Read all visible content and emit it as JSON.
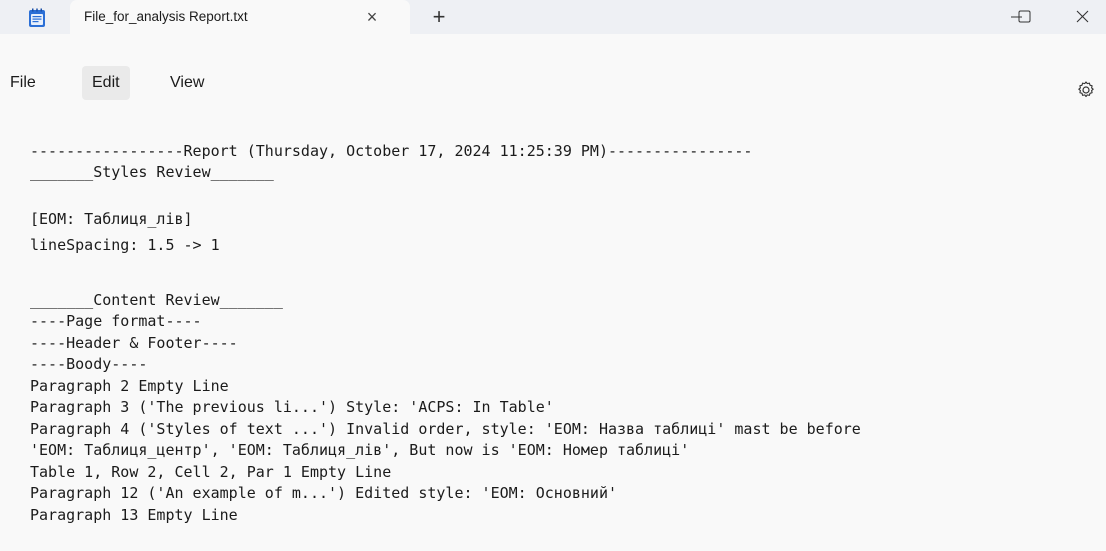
{
  "window": {
    "tab_title": "File_for_analysis Report.txt",
    "tab_close_glyph": "×",
    "new_tab_glyph": "+",
    "minimize_glyph": "–",
    "maximize_glyph": "☐",
    "close_glyph": "×"
  },
  "menu": {
    "file": "File",
    "edit": "Edit",
    "view": "View",
    "selected": "Edit"
  },
  "icons": {
    "app": "notepad-icon",
    "settings": "gear-icon"
  },
  "colors": {
    "titlebar": "#eef0f4",
    "surface": "#f9f9f9",
    "app_icon_blue": "#2b6fd6"
  },
  "document": {
    "lines": [
      "-----------------Report (Thursday, October 17, 2024 11:25:39 PM)----------------",
      "_______Styles Review_______",
      "",
      "[EOM: Таблиця_лів]",
      "lineSpacing: 1.5 -> 1",
      "",
      "_______Content Review_______",
      "----Page format----",
      "----Header & Footer----",
      "----Boody----",
      "Paragraph 2 Empty Line",
      "Paragraph 3 ('The previous li...') Style: 'ACPS: In Table'",
      "Paragraph 4 ('Styles of text ...') Invalid order, style: 'EOM: Назва таблиці' mast be before",
      "'EOM: Таблиця_центр', 'EOM: Таблиця_лів', But now is 'EOM: Номер таблиці'",
      "Table 1, Row 2, Cell 2, Par 1 Empty Line",
      "Paragraph 12 ('An example of m...') Edited style: 'EOM: Основний'",
      "Paragraph 13 Empty Line"
    ]
  }
}
